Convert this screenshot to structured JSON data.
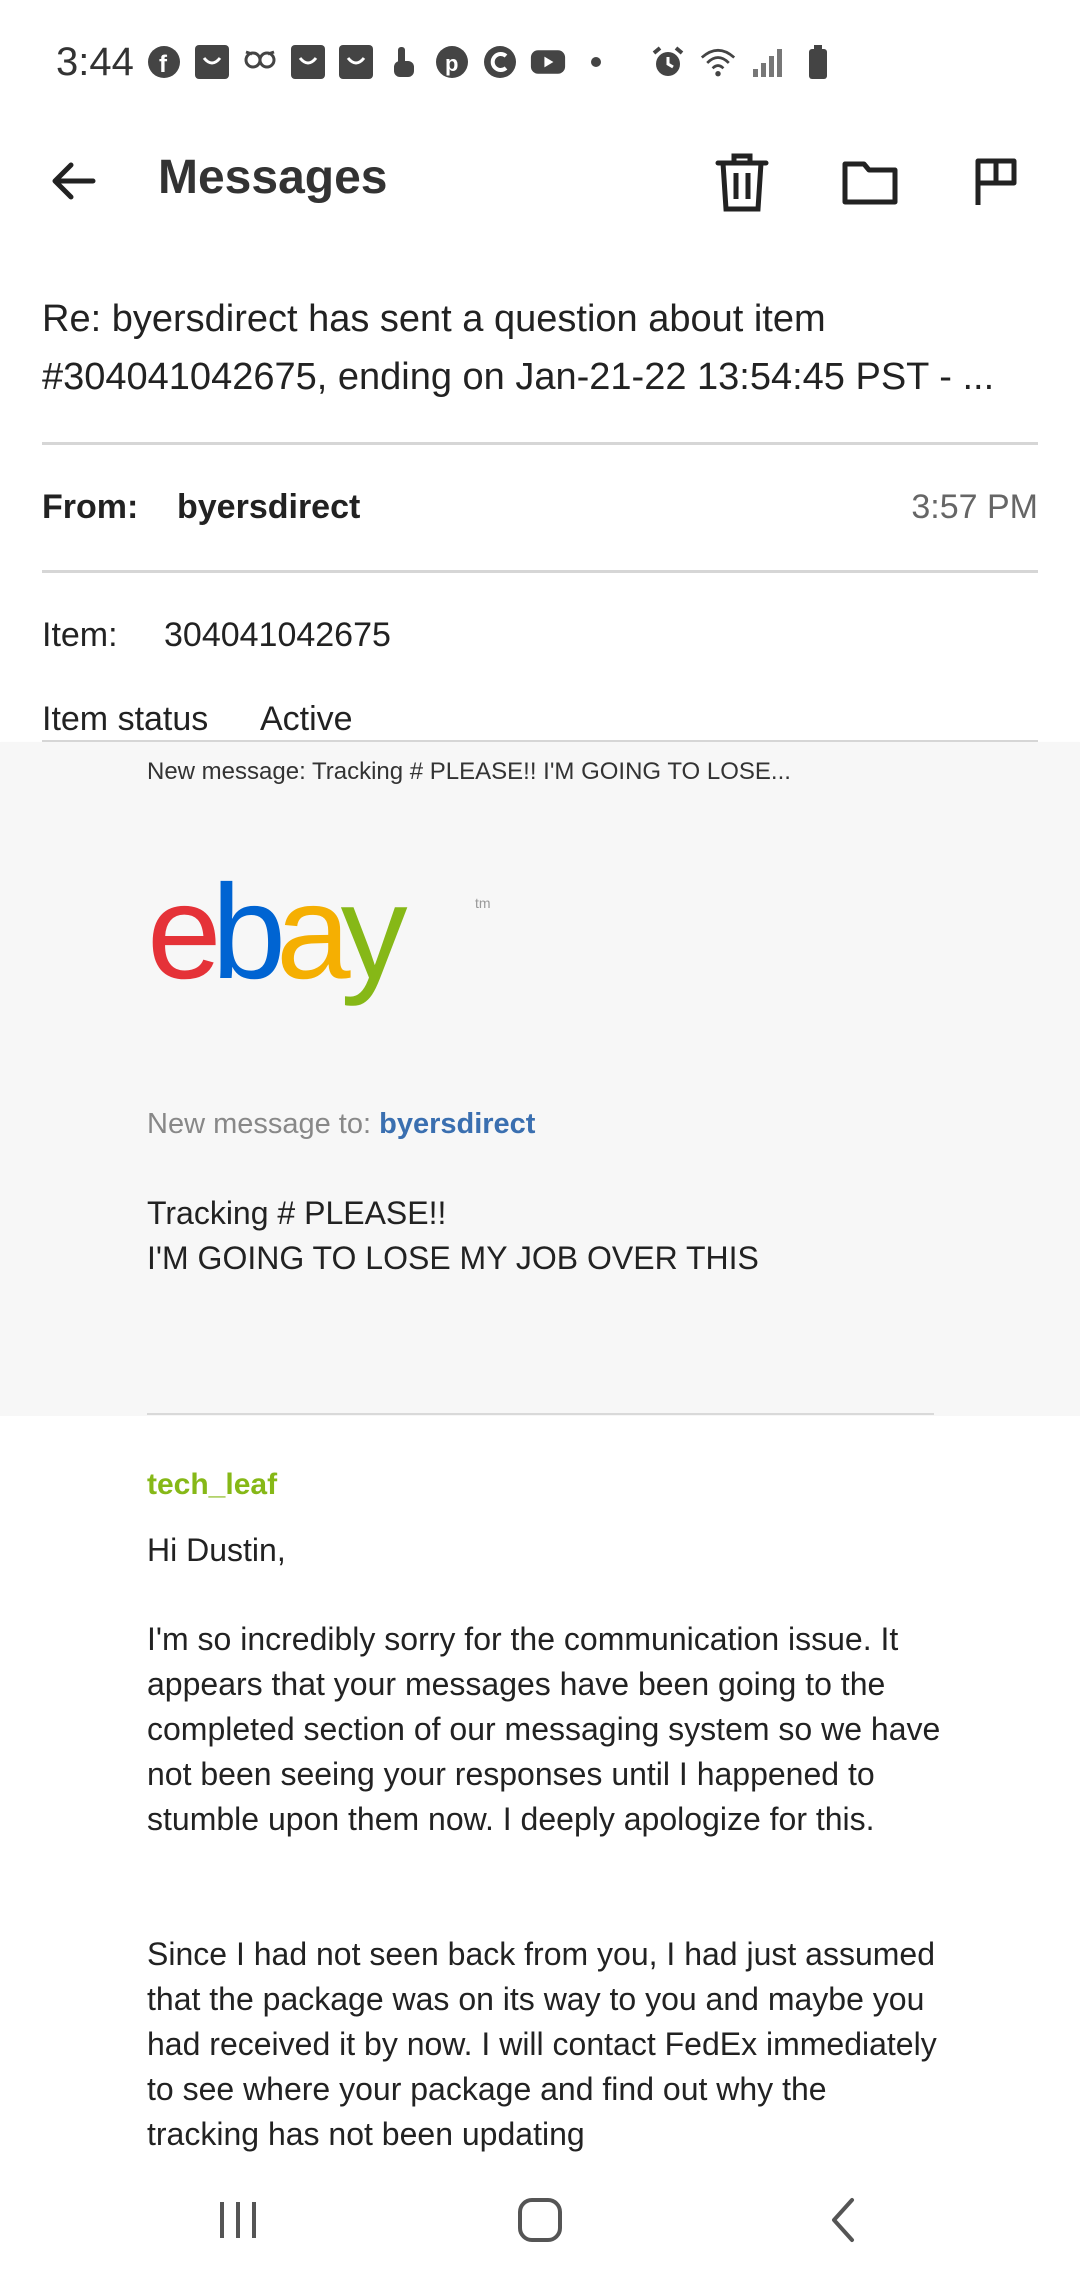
{
  "status_bar": {
    "time": "3:44",
    "left_icons": [
      "facebook-icon",
      "pocket-icon",
      "hootsuite-icon",
      "pocket-icon",
      "pocket-icon",
      "hand-icon",
      "pinterest-icon",
      "ccleaner-icon",
      "youtube-icon",
      "dot-icon"
    ],
    "right_icons": [
      "alarm-icon",
      "wifi-icon",
      "signal-icon",
      "battery-icon"
    ]
  },
  "app_bar": {
    "title": "Messages",
    "actions": [
      "delete-icon",
      "folder-icon",
      "flag-icon"
    ]
  },
  "message": {
    "subject": "Re: byersdirect has sent a question about item #304041042675, ending on Jan-21-22 13:54:45 PST - ...",
    "from_label": "From:",
    "from_value": "byersdirect",
    "time": "3:57 PM",
    "item_label": "Item:",
    "item_value": "304041042675",
    "status_label": "Item status",
    "status_value": "Active"
  },
  "email": {
    "preview": "New message: Tracking # PLEASE!! I'M GOING TO LOSE...",
    "logo_text": "ebay",
    "logo_tm": "tm",
    "to_prefix": "New message to:",
    "to_user": "byersdirect",
    "msg_line1": "Tracking # PLEASE!!",
    "msg_line2": "I'M GOING TO LOSE MY JOB OVER THIS",
    "reply_sender": "tech_leaf",
    "greeting": "Hi Dustin,",
    "para1": "I'm so incredibly sorry for the communication issue. It appears that your messages have been going to the completed section of our messaging system so we have not been seeing your responses until I happened to stumble upon them now. I deeply apologize for this.",
    "para2": "Since I had not seen back from you, I had just assumed that the package was on its way to you and maybe you had received it by now. I will contact FedEx immediately to see where your package and find out why the tracking has not been updating"
  },
  "colors": {
    "ebay_red": "#e53238",
    "ebay_blue": "#0064d2",
    "ebay_yellow": "#f5af02",
    "ebay_green": "#86b817",
    "link_blue": "#3a6fb0"
  },
  "nav_bar": {
    "buttons": [
      "recents-icon",
      "home-icon",
      "back-icon"
    ]
  }
}
